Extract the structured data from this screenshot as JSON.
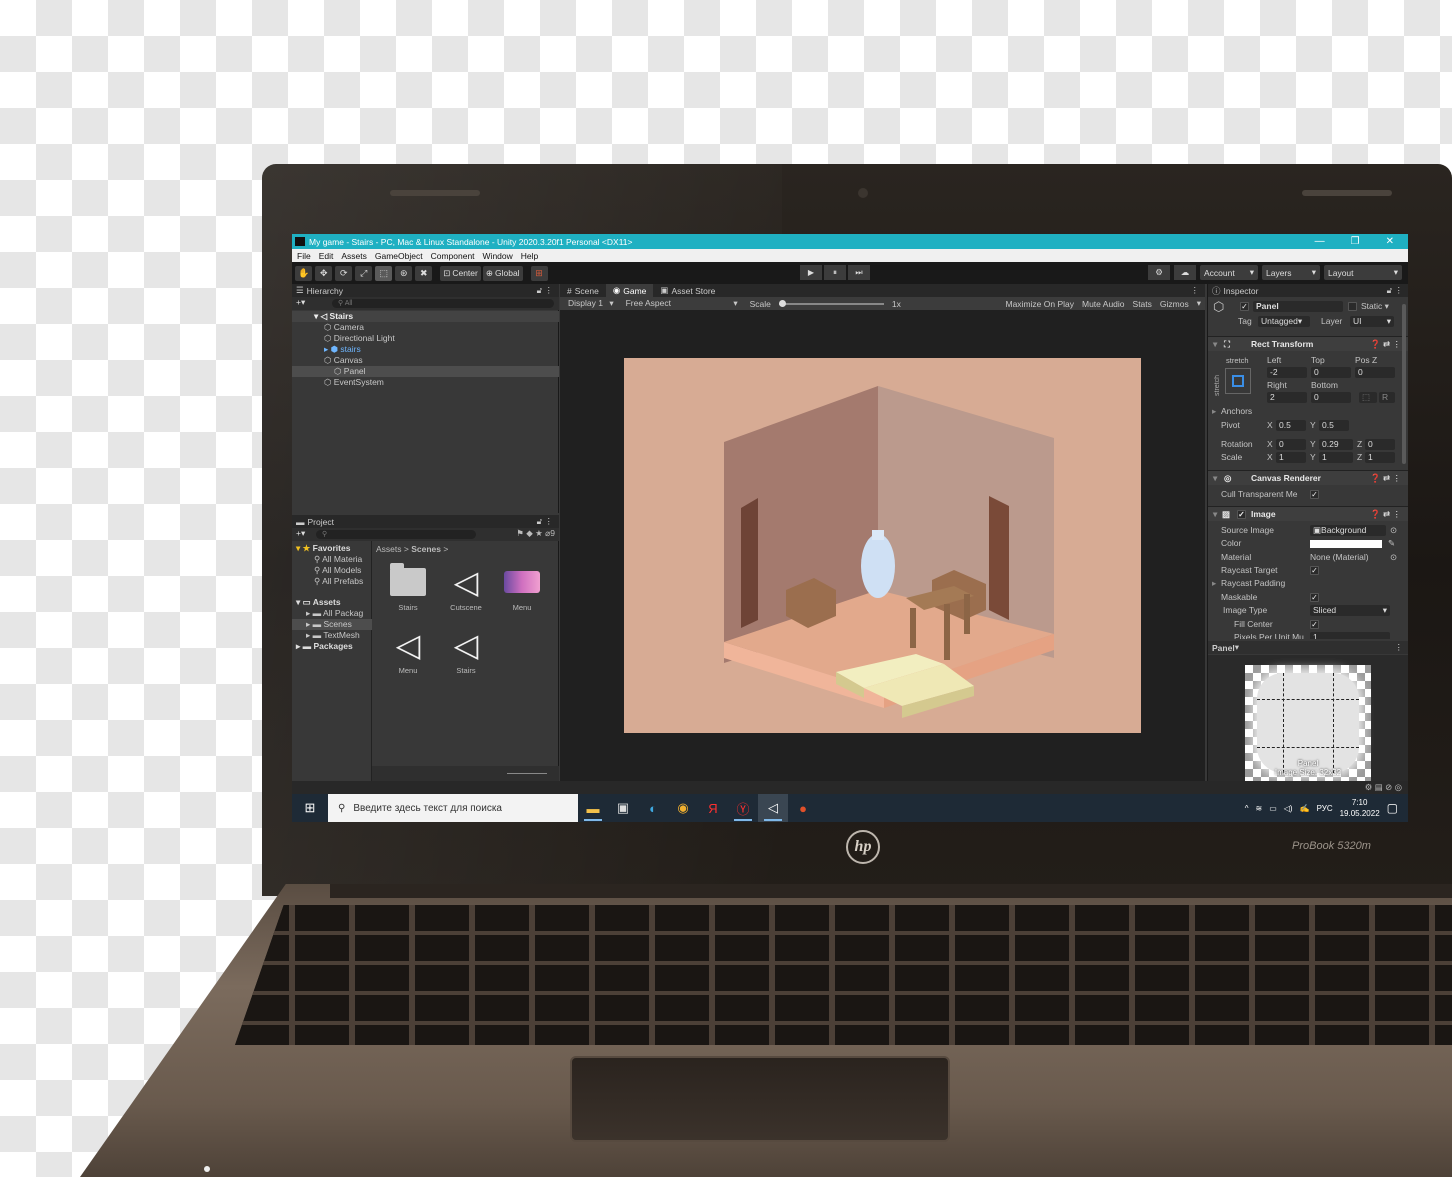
{
  "window": {
    "title": "My game - Stairs - PC, Mac & Linux Standalone - Unity 2020.3.20f1 Personal <DX11>",
    "controls": [
      "—",
      "❐",
      "✕"
    ]
  },
  "menu": [
    "File",
    "Edit",
    "Assets",
    "GameObject",
    "Component",
    "Window",
    "Help"
  ],
  "toolbar": {
    "tools": [
      "✋",
      "✥",
      "⟳",
      "⤢",
      "⬚",
      "⊛",
      "✖"
    ],
    "pivot": "Center",
    "space": "Global",
    "play": [
      "▶",
      "⏸",
      "⏭"
    ],
    "account": "Account",
    "layers": "Layers",
    "layout": "Layout"
  },
  "hierarchy": {
    "title": "Hierarchy",
    "search_placeholder": "All",
    "items": [
      {
        "label": "Stairs",
        "depth": 0,
        "kind": "scene"
      },
      {
        "label": "Camera",
        "depth": 1
      },
      {
        "label": "Directional Light",
        "depth": 1
      },
      {
        "label": "stairs",
        "depth": 1,
        "kind": "prefab"
      },
      {
        "label": "Canvas",
        "depth": 1
      },
      {
        "label": "Panel",
        "depth": 2,
        "kind": "selected"
      },
      {
        "label": "EventSystem",
        "depth": 1
      }
    ]
  },
  "project": {
    "title": "Project",
    "count": "9",
    "breadcrumb_root": "Assets",
    "breadcrumb_current": "Scenes",
    "favorites_label": "Favorites",
    "favorites": [
      "All Materia",
      "All Models",
      "All Prefabs"
    ],
    "assets_label": "Assets",
    "assets_children": [
      "All Packag",
      "Scenes",
      "TextMesh"
    ],
    "packages_label": "Packages",
    "files": [
      {
        "name": "Stairs",
        "kind": "folder"
      },
      {
        "name": "Cutscene",
        "kind": "unity"
      },
      {
        "name": "Menu",
        "kind": "image"
      },
      {
        "name": "Menu",
        "kind": "unity"
      },
      {
        "name": "Stairs",
        "kind": "unity"
      }
    ]
  },
  "center_tabs": [
    "Scene",
    "Game",
    "Asset Store"
  ],
  "game": {
    "display": "Display 1",
    "aspect": "Free Aspect",
    "scale_label": "Scale",
    "scale_value": "1x",
    "options": [
      "Maximize On Play",
      "Mute Audio",
      "Stats",
      "Gizmos"
    ]
  },
  "inspector": {
    "title": "Inspector",
    "object_name": "Panel",
    "static_label": "Static",
    "tag_label": "Tag",
    "tag_value": "Untagged",
    "layer_label": "Layer",
    "layer_value": "UI",
    "rect_transform": {
      "title": "Rect Transform",
      "stretch": "stretch",
      "left_label": "Left",
      "left": "-2",
      "top_label": "Top",
      "top": "0",
      "posz_label": "Pos Z",
      "posz": "0",
      "right_label": "Right",
      "right": "2",
      "bottom_label": "Bottom",
      "bottom": "0",
      "anchors_label": "Anchors",
      "pivot_label": "Pivot",
      "pivot_x": "0.5",
      "pivot_y": "0.5",
      "rotation_label": "Rotation",
      "rot_x": "0",
      "rot_y": "0.29",
      "rot_z": "0",
      "scale_label": "Scale",
      "scale_x": "1",
      "scale_y": "1",
      "scale_z": "1"
    },
    "canvas_renderer": {
      "title": "Canvas Renderer",
      "cull_label": "Cull Transparent Me"
    },
    "image": {
      "title": "Image",
      "source_label": "Source Image",
      "source_value": "Background",
      "color_label": "Color",
      "material_label": "Material",
      "material_value": "None (Material)",
      "raycast_target_label": "Raycast Target",
      "raycast_padding_label": "Raycast Padding",
      "maskable_label": "Maskable",
      "image_type_label": "Image Type",
      "image_type_value": "Sliced",
      "fill_center_label": "Fill Center",
      "ppu_label": "Pixels Per Unit Mu",
      "ppu_value": "1"
    },
    "preview": {
      "header": "Panel",
      "caption_name": "Panel",
      "caption_size": "Image Size: 32x32"
    }
  },
  "taskbar": {
    "search_placeholder": "Введите здесь текст для поиска",
    "lang": "РУС",
    "time": "7:10",
    "date": "19.05.2022"
  },
  "laptop": {
    "brand": "hp",
    "model": "ProBook 5320m"
  },
  "colors": {
    "titlebar": "#1fb0c2",
    "game_bg": "#d7ab94",
    "editor_bg": "#383838"
  }
}
